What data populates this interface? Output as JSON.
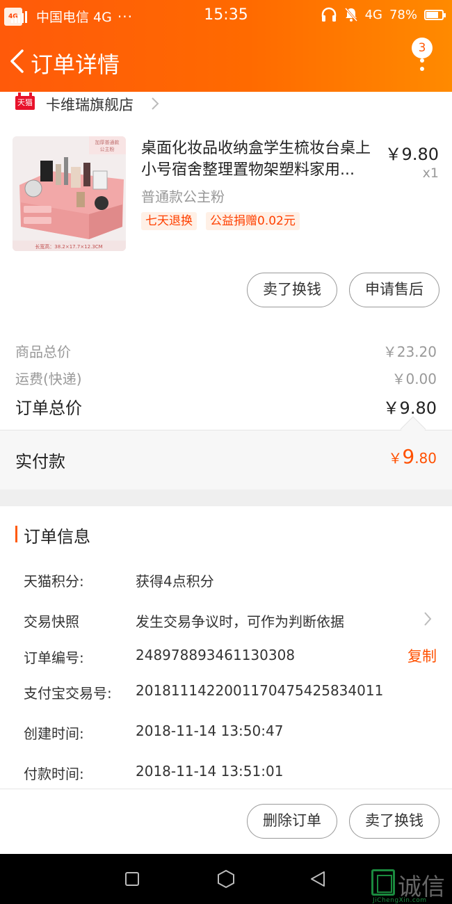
{
  "status_bar": {
    "network_tag": "4G",
    "carrier": "中国电信 4G",
    "dots": "···",
    "time": "15:35",
    "network": "4G",
    "battery": "78%",
    "battery_level": 0.78
  },
  "header": {
    "title": "订单详情",
    "badge_count": "3"
  },
  "store": {
    "logo_text": "天猫",
    "name": "卡维瑞旗舰店"
  },
  "product": {
    "title": "桌面化妆品收纳盒学生梳妆台桌上小号宿舍整理置物架塑料家用...",
    "price": "￥9.80",
    "quantity": "x1",
    "sku": "普通款公主粉",
    "tags": [
      "七天退换",
      "公益捐赠0.02元"
    ],
    "image_top_label": "加厚普通款 公主粉",
    "image_dimensions": "长宽高：38.2×17.7×12.3CM"
  },
  "item_actions": {
    "sell_button": "卖了换钱",
    "after_sale_button": "申请售后"
  },
  "summary": {
    "goods_total_label": "商品总价",
    "goods_total_value": "￥23.20",
    "shipping_label": "运费(快递)",
    "shipping_value": "￥0.00",
    "order_total_label": "订单总价",
    "order_total_value": "￥9.80",
    "paid_label": "实付款",
    "paid_currency": "￥",
    "paid_integer": "9",
    "paid_decimal": ".80"
  },
  "order_info": {
    "section_title": "订单信息",
    "rows": [
      {
        "label": "天猫积分:",
        "value": "获得4点积分"
      },
      {
        "label": "交易快照",
        "value": "发生交易争议时，可作为判断依据"
      },
      {
        "label": "订单编号:",
        "value": "248978893461130308"
      },
      {
        "label": "支付宝交易号:",
        "value": "2018111422001170475425834011"
      },
      {
        "label": "创建时间:",
        "value": "2018-11-14 13:50:47"
      },
      {
        "label": "付款时间:",
        "value": "2018-11-14 13:51:01"
      }
    ],
    "copy_label": "复制"
  },
  "footer_actions": {
    "delete_button": "删除订单",
    "sell_button": "卖了换钱"
  },
  "watermark": {
    "text": "诚信",
    "sub": "JiChengXin.com"
  },
  "colors": {
    "accent": "#ff5000",
    "header_start": "#ff5a0a",
    "header_end": "#ff8a00"
  }
}
